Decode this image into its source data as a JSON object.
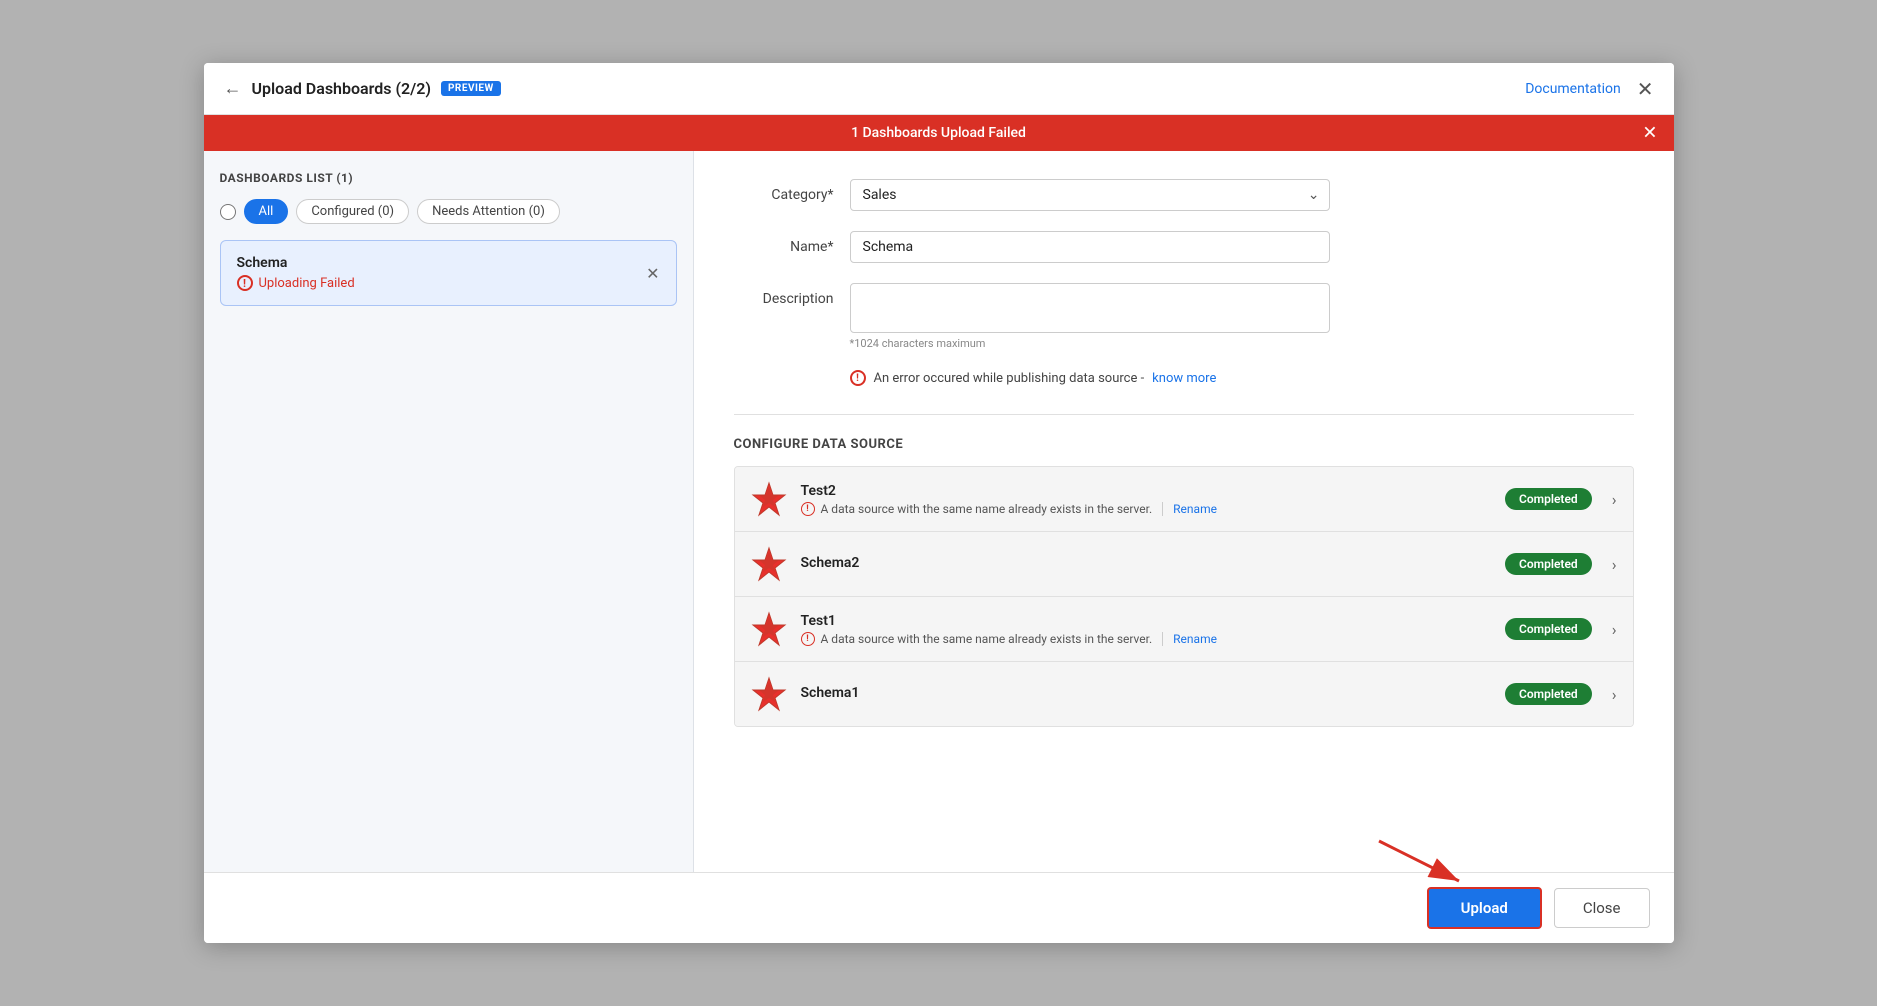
{
  "modal": {
    "title": "Upload Dashboards (2/2)",
    "preview_badge": "PREVIEW",
    "documentation_label": "Documentation",
    "error_banner": "1 Dashboards Upload Failed",
    "sidebar": {
      "title": "DASHBOARDS LIST (1)",
      "filters": [
        {
          "label": "All",
          "active": true
        },
        {
          "label": "Configured (0)",
          "active": false
        },
        {
          "label": "Needs Attention (0)",
          "active": false
        }
      ],
      "dashboard_card": {
        "name": "Schema",
        "status": "Uploading Failed"
      }
    },
    "form": {
      "category_label": "Category*",
      "category_value": "Sales",
      "name_label": "Name*",
      "name_value": "Schema",
      "description_label": "Description",
      "description_value": "",
      "description_hint": "*1024 characters maximum",
      "error_message_text": "An error occured while publishing data source -",
      "know_more_label": "know more"
    },
    "configure_section": {
      "title": "CONFIGURE DATA SOURCE",
      "items": [
        {
          "name": "Test2",
          "has_warning": true,
          "warning_text": "A data source with the same name already exists in the server.",
          "rename_label": "Rename",
          "status": "Completed"
        },
        {
          "name": "Schema2",
          "has_warning": false,
          "warning_text": "",
          "rename_label": "",
          "status": "Completed"
        },
        {
          "name": "Test1",
          "has_warning": true,
          "warning_text": "A data source with the same name already exists in the server.",
          "rename_label": "Rename",
          "status": "Completed"
        },
        {
          "name": "Schema1",
          "has_warning": false,
          "warning_text": "",
          "rename_label": "",
          "status": "Completed"
        }
      ]
    },
    "footer": {
      "upload_label": "Upload",
      "close_label": "Close"
    }
  }
}
